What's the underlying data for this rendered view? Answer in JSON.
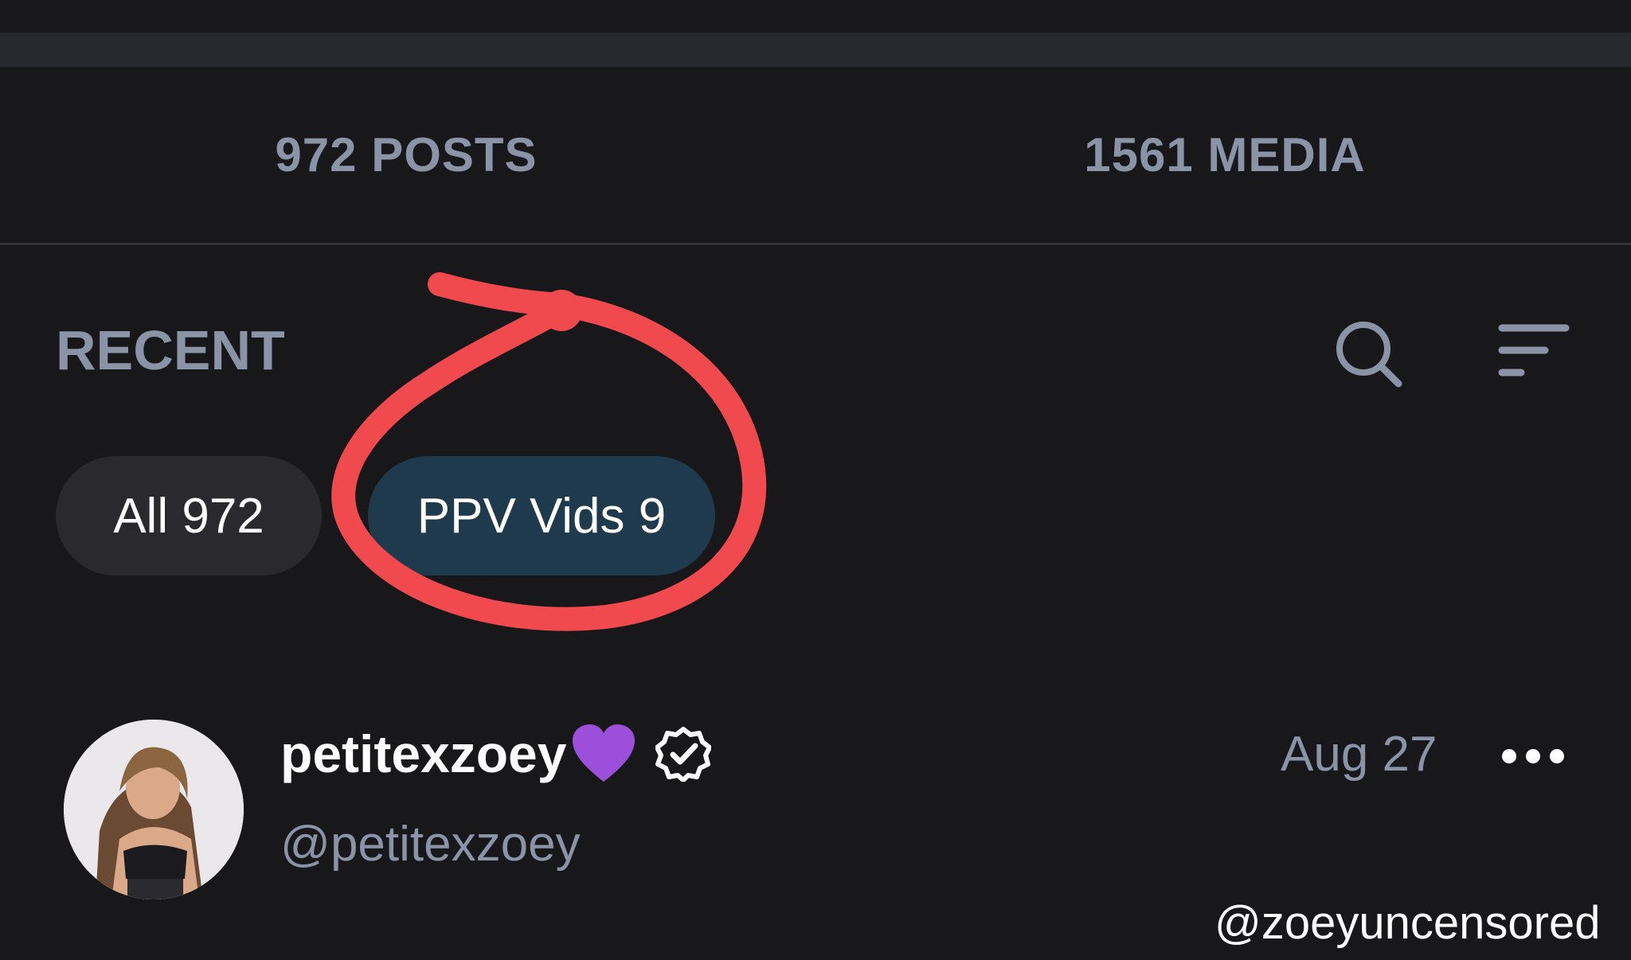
{
  "stats": {
    "posts_label": "972 POSTS",
    "media_label": "1561 MEDIA"
  },
  "section": {
    "title": "RECENT"
  },
  "filters": [
    {
      "label": "All 972",
      "selected": false
    },
    {
      "label": "PPV Vids 9",
      "selected": true
    }
  ],
  "annotation": {
    "color": "#f04a4f"
  },
  "post": {
    "display_name": "petitexzoey",
    "handle": "@petitexzoey",
    "date": "Aug 27",
    "verified": true
  },
  "icons": {
    "search": "search-icon",
    "sort": "sort-icon",
    "heart": "purple-heart-icon",
    "verified": "verified-badge-icon",
    "more": "more-horizontal-icon"
  },
  "colors": {
    "background": "#18181b",
    "top_bar": "#28292e",
    "muted_text": "#8a94a6",
    "chip_default": "#29292e",
    "chip_selected": "#1f3a4d",
    "heart": "#9b4fdb"
  },
  "watermark": "@zoeyuncensored"
}
